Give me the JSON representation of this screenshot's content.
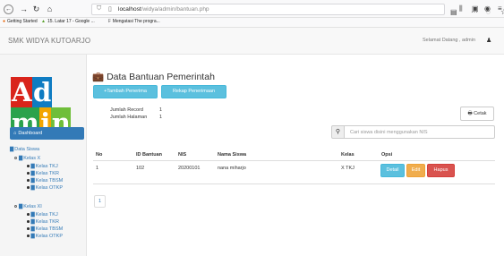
{
  "browser": {
    "url_base": "localhost",
    "url_path": "/widya/admin/bantuan.php",
    "bookmarks": [
      {
        "label": "Getting Started"
      },
      {
        "label": "15. Latar 17 - Google ..."
      },
      {
        "label": "Mengatasi The progra..."
      }
    ]
  },
  "navbar": {
    "brand": "SMK WIDYA KUTOARJO",
    "welcome": "Selamat Datang , admin"
  },
  "sidebar": {
    "logo_letters": [
      "A",
      "d",
      "m",
      "i",
      "n"
    ],
    "dashboard": "Dashboard",
    "data_siswa": "Data Siswa",
    "groups": [
      {
        "label": "Kelas X",
        "items": [
          "Kelas TKJ",
          "Kelas TKR",
          "Kelas TBSM",
          "Kelas OTKP"
        ]
      },
      {
        "label": "Kelas XI",
        "items": [
          "Kelas TKJ",
          "Kelas TKR",
          "Kelas TBSM",
          "Kelas OTKP"
        ]
      }
    ]
  },
  "main": {
    "title": "Data Bantuan Pemerintah",
    "add_button": "+Tambah Penerima",
    "recap_button": "Rekap Penerimaan",
    "jumlah_record_label": "Jumlah Record",
    "jumlah_record_value": "1",
    "jumlah_halaman_label": "Jumlah Halaman",
    "jumlah_halaman_value": "1",
    "print_button": "Cetak",
    "search_placeholder": "Cari siswa disini menggunakan NIS",
    "table": {
      "headers": [
        "No",
        "ID Bantuan",
        "NIS",
        "Nama Siswa",
        "Kelas",
        "Opsi"
      ],
      "rows": [
        {
          "no": "1",
          "id_bantuan": "102",
          "nis": "20200101",
          "nama": "nana miharjo",
          "kelas": "X TKJ"
        }
      ],
      "actions": {
        "detail": "Detail",
        "edit": "Edit",
        "delete": "Hapus"
      }
    },
    "pagination": [
      "1"
    ]
  }
}
